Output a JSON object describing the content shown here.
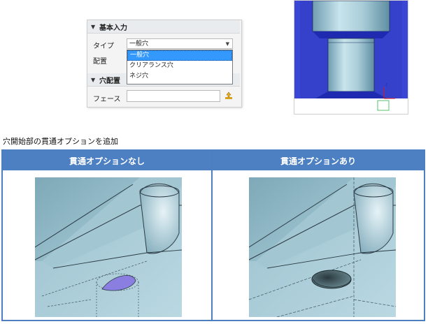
{
  "panel": {
    "basic_section": "基本入力",
    "type_label": "タイプ",
    "type_value": "一般穴",
    "placement_label": "配置",
    "dropdown_options": [
      "一般穴",
      "クリアランス穴",
      "ネジ穴"
    ],
    "placement_section": "穴配置",
    "face_label": "フェース",
    "face_value": ""
  },
  "caption": "穴開始部の貫通オプションを追加",
  "table": {
    "col1": "貫通オプションなし",
    "col2": "貫通オプションあり"
  },
  "colors": {
    "accent": "#4d7fc3",
    "selection": "#3399ff",
    "preview_bg": "#3a46d6",
    "model_fill": "#a9cdd8"
  }
}
